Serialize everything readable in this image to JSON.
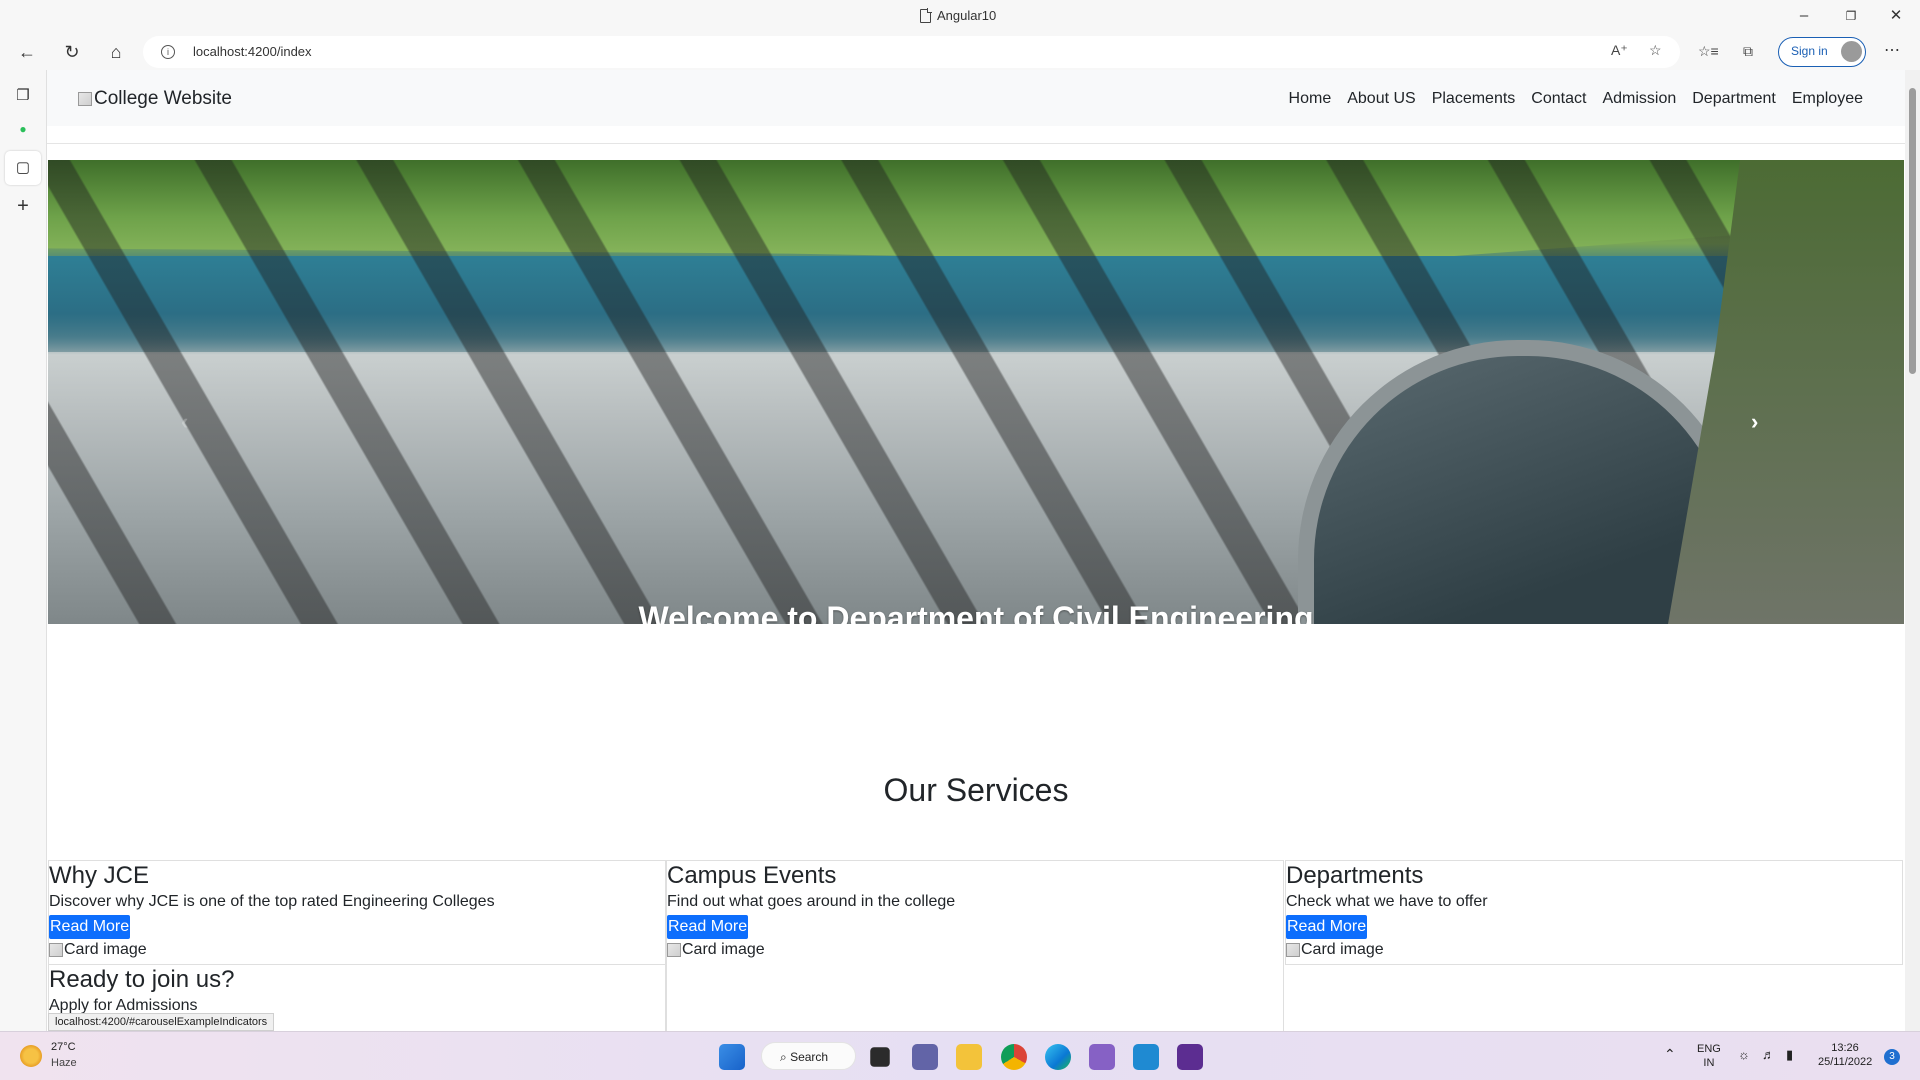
{
  "window": {
    "title": "Angular10"
  },
  "browser": {
    "url": "localhost:4200/index",
    "signin_label": "Sign in",
    "status_url": "localhost:4200/#carouselExampleIndicators"
  },
  "site": {
    "brand": "College Website",
    "nav": [
      "Home",
      "About US",
      "Placements",
      "Contact",
      "Admission",
      "Department",
      "Employee"
    ],
    "hero_caption": "Welcome to Department of Civil Engineering",
    "services_title": "Our Services",
    "cards": [
      {
        "title": "Why JCE",
        "text": "Discover why JCE is one of the top rated Engineering Colleges",
        "button": "Read More",
        "image_alt": "Card image"
      },
      {
        "title": "Campus Events",
        "text": "Find out what goes around in the college",
        "button": "Read More",
        "image_alt": "Card image"
      },
      {
        "title": "Departments",
        "text": "Check what we have to offer",
        "button": "Read More",
        "image_alt": "Card image"
      },
      {
        "title": "Ready to join us?",
        "text": "Apply for Admissions"
      }
    ]
  },
  "taskbar": {
    "weather_temp": "27°C",
    "weather_desc": "Haze",
    "search_label": "Search",
    "lang_top": "ENG",
    "lang_bottom": "IN",
    "time": "13:26",
    "date": "25/11/2022",
    "notification_count": "3"
  },
  "colors": {
    "primary_button": "#0d6efd",
    "accent_signin": "#1a5fb4"
  }
}
